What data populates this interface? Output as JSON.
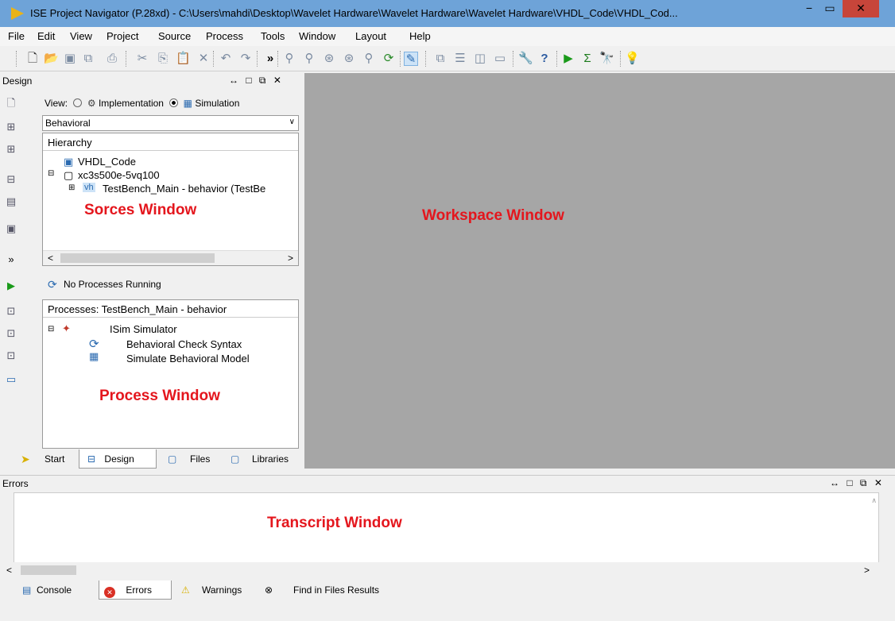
{
  "window": {
    "title": "ISE Project Navigator (P.28xd) - C:\\Users\\mahdi\\Desktop\\Wavelet Hardware\\Wavelet Hardware\\Wavelet Hardware\\VHDL_Code\\VHDL_Cod...",
    "min_symbol": "−",
    "max_symbol": "▭",
    "close_symbol": "✕"
  },
  "menu": [
    "File",
    "Edit",
    "View",
    "Project",
    "Source",
    "Process",
    "Tools",
    "Window",
    "Layout",
    "Help"
  ],
  "toolbar": {
    "overflow_symbol": "»",
    "icons": [
      "new-file-icon",
      "open-folder-icon",
      "save-icon",
      "save-all-icon",
      "print-icon",
      "cut-icon",
      "copy-icon",
      "paste-icon",
      "delete-icon",
      "undo-icon",
      "redo-icon",
      "zoom-in-icon",
      "zoom-out-icon",
      "zoom-fit-icon",
      "zoom-full-icon",
      "find-icon",
      "refresh-icon",
      "highlight-icon",
      "cascade-icon",
      "tile-horizontal-icon",
      "tile-vertical-icon",
      "restore-icon",
      "wrench-icon",
      "whats-this-icon",
      "run-icon",
      "sigma-icon",
      "telescope-icon",
      "lightbulb-icon"
    ]
  },
  "design_panel": {
    "title": "Design",
    "controls": "↔ □ ⧉ ✕",
    "view_label": "View:",
    "view_options": [
      "Implementation",
      "Simulation"
    ],
    "selected_view": "Simulation",
    "dropdown_value": "Behavioral",
    "hierarchy_header": "Hierarchy",
    "tree": [
      "VHDL_Code",
      "xc3s500e-5vq100",
      "TestBench_Main - behavior (TestBe"
    ],
    "sources_label": "Sorces Window",
    "no_processes": "No Processes Running",
    "processes_header": "Processes: TestBench_Main - behavior",
    "process_tree": [
      "ISim Simulator",
      "Behavioral Check Syntax",
      "Simulate Behavioral Model"
    ],
    "process_label": "Process Window",
    "tabs": [
      "Start",
      "Design",
      "Files",
      "Libraries"
    ],
    "active_tab": "Design"
  },
  "workspace": {
    "label": "Workspace Window"
  },
  "errors_pane": {
    "title": "Errors",
    "controls": "↔ □ ⧉ ✕",
    "transcript_label": "Transcript Window",
    "tabs": [
      "Console",
      "Errors",
      "Warnings",
      "Find in Files Results"
    ],
    "active_tab": "Errors"
  },
  "colors": {
    "label_red": "#e4161d",
    "workspace_gray": "#a6a6a6",
    "titlebar_blue": "#6ea3d8",
    "close_red": "#c7453a"
  }
}
